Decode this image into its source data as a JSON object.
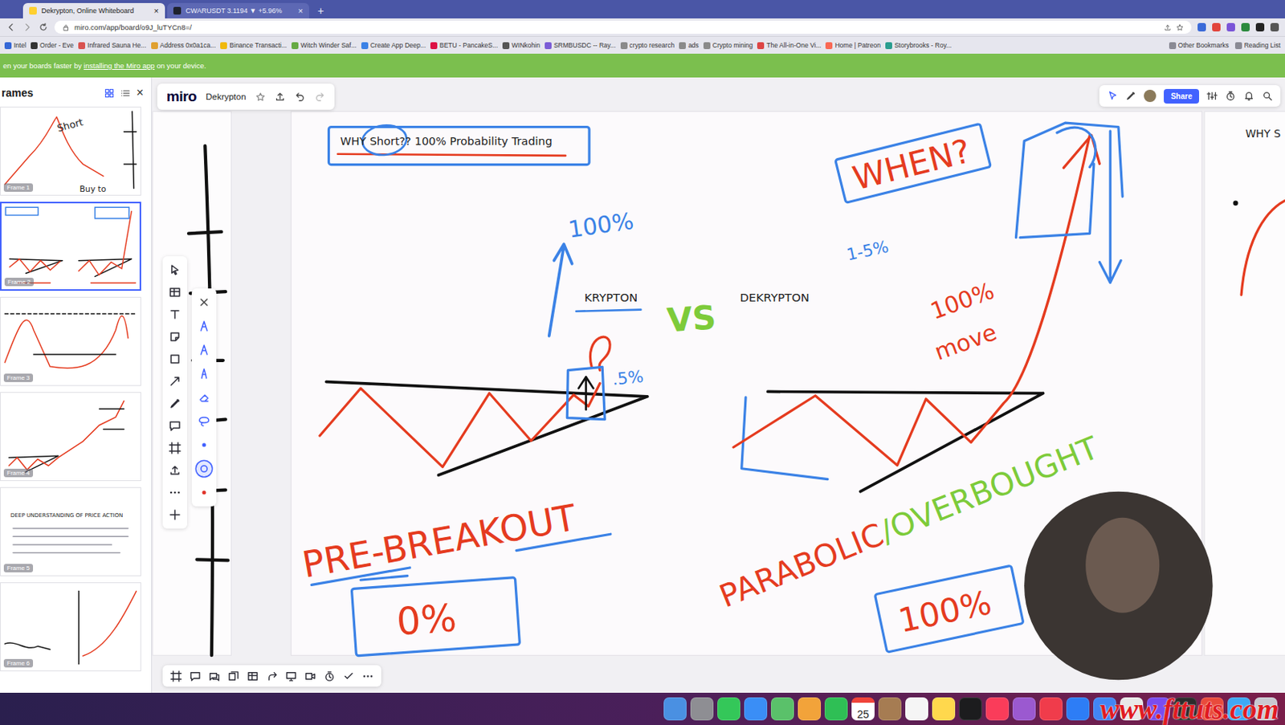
{
  "browser": {
    "tabs": [
      {
        "label": "Dekrypton, Online Whiteboard",
        "close": "×",
        "selected": true
      },
      {
        "label": "CWARUSDT 3.1194 ▼ +5.96%",
        "close": "×",
        "selected": false
      }
    ],
    "new_tab": "+",
    "url": "miro.com/app/board/o9J_luTYCn8=/",
    "bookmarks": [
      "Intel",
      "Order - Eve",
      "Infrared Sauna He...",
      "Address 0x0a1ca...",
      "Binance Transacti...",
      "Witch Winder Saf...",
      "Create App Deep...",
      "BETU - PancakeS...",
      "WINkohin",
      "SRMBUSDC -- Ray...",
      "crypto research",
      "ads",
      "Crypto mining",
      "The All-in-One Vi...",
      "Home | Patreon",
      "Storybrooks - Roy..."
    ],
    "bookmarks_right": [
      "Other Bookmarks",
      "Reading List"
    ]
  },
  "banner": {
    "before": "en your boards faster by ",
    "link": "installing the Miro app",
    "after": " on your device."
  },
  "frames_panel": {
    "title": "rames",
    "close": "×",
    "frames": [
      {
        "label": "Frame 1",
        "kind": "peak",
        "selected": false,
        "texts": [
          "Short",
          "Buy to"
        ]
      },
      {
        "label": "Frame 2",
        "kind": "compare",
        "selected": true,
        "texts": []
      },
      {
        "label": "Frame 3",
        "kind": "double",
        "selected": false,
        "texts": []
      },
      {
        "label": "Frame 4",
        "kind": "breakout",
        "selected": false,
        "texts": []
      },
      {
        "label": "Frame 5",
        "kind": "text",
        "selected": false,
        "texts": [
          "DEEP UNDERSTANDING OF PRICE ACTION"
        ]
      },
      {
        "label": "Frame 6",
        "kind": "chart",
        "selected": false,
        "texts": []
      }
    ]
  },
  "toolbar": {
    "logo": "miro",
    "board_name": "Dekrypton",
    "share": "Share"
  },
  "tools": [
    {
      "kind": "select"
    },
    {
      "kind": "table"
    },
    {
      "kind": "text"
    },
    {
      "kind": "sticky"
    },
    {
      "kind": "shape"
    },
    {
      "kind": "arrow"
    },
    {
      "kind": "pen"
    },
    {
      "kind": "comment"
    },
    {
      "kind": "frame"
    },
    {
      "kind": "upload"
    },
    {
      "kind": "more"
    },
    {
      "kind": "apps"
    }
  ],
  "pen_panel": [
    {
      "kind": "close",
      "selected": false
    },
    {
      "kind": "pen2",
      "selected": false
    },
    {
      "kind": "pen2",
      "selected": false
    },
    {
      "kind": "highlighter",
      "selected": false
    },
    {
      "kind": "eraser",
      "selected": false
    },
    {
      "kind": "lasso",
      "selected": false
    },
    {
      "kind": "dot",
      "selected": false
    },
    {
      "kind": "ring",
      "selected": true
    },
    {
      "kind": "reddot",
      "selected": false
    }
  ],
  "board": {
    "annotations": [
      {
        "text": "WHY Short?? 100% Probability Trading",
        "kind": "label",
        "color": "#222222"
      },
      {
        "text": "KRYPTON",
        "kind": "label",
        "color": "#222222"
      },
      {
        "text": "VS",
        "kind": "label",
        "color": "#7dcb3a"
      },
      {
        "text": "DEKRYPTON",
        "kind": "label",
        "color": "#222222"
      },
      {
        "text": "100%",
        "kind": "label",
        "color": "#3b82e6"
      },
      {
        "text": ".5%",
        "kind": "label",
        "color": "#3b82e6"
      },
      {
        "text": "WHEN?",
        "kind": "label",
        "color": "#e53b1f"
      },
      {
        "text": "1-5%",
        "kind": "label",
        "color": "#3b82e6"
      },
      {
        "text": "100%",
        "kind": "label",
        "color": "#e53b1f"
      },
      {
        "text": "move",
        "kind": "label",
        "color": "#e53b1f"
      },
      {
        "text": "PRE-BREAKOUT",
        "kind": "label",
        "color": "#e53b1f"
      },
      {
        "text": "0%",
        "kind": "label",
        "color": "#e53b1f"
      },
      {
        "text": "PARABOLIC",
        "kind": "label",
        "color": "#e53b1f"
      },
      {
        "text": "/OVERBOUGHT",
        "kind": "continuation",
        "color": "#7dcb3a"
      },
      {
        "text": "100%",
        "kind": "label",
        "color": "#e53b1f"
      },
      {
        "text": "WHY S",
        "kind": "label",
        "color": "#222222"
      }
    ]
  },
  "bottom_toolbar": [
    {
      "kind": "frame"
    },
    {
      "kind": "comment"
    },
    {
      "kind": "chat"
    },
    {
      "kind": "cards"
    },
    {
      "kind": "table"
    },
    {
      "kind": "share"
    },
    {
      "kind": "screen"
    },
    {
      "kind": "video"
    },
    {
      "kind": "timer"
    },
    {
      "kind": "vote"
    },
    {
      "kind": "more"
    }
  ],
  "dock": {
    "apps": [
      {
        "kind": "app",
        "color": "#4a90e2"
      },
      {
        "kind": "app",
        "color": "#8e8e93"
      },
      {
        "kind": "app",
        "color": "#34c759"
      },
      {
        "kind": "app",
        "color": "#3a8ef6"
      },
      {
        "kind": "app",
        "color": "#5ac16a"
      },
      {
        "kind": "app",
        "color": "#f2a33a"
      },
      {
        "kind": "app",
        "color": "#2fbf55"
      },
      {
        "kind": "calendar",
        "label": "25"
      },
      {
        "kind": "app",
        "color": "#a67c52"
      },
      {
        "kind": "app",
        "color": "#f5f5f5"
      },
      {
        "kind": "app",
        "color": "#ffd84d"
      },
      {
        "kind": "app",
        "color": "#1c1c1e"
      },
      {
        "kind": "app",
        "color": "#fa3c5a"
      },
      {
        "kind": "app",
        "color": "#9b59d0"
      },
      {
        "kind": "app",
        "color": "#f03c4b"
      },
      {
        "kind": "app",
        "color": "#2d7df6"
      },
      {
        "kind": "app",
        "color": "#4285f4"
      },
      {
        "kind": "app",
        "color": "#e8e8e8"
      },
      {
        "kind": "app",
        "color": "#7a4cf0"
      },
      {
        "kind": "app",
        "color": "#2b2b2b"
      },
      {
        "kind": "app",
        "color": "#e94b3c"
      },
      {
        "kind": "app",
        "color": "#3fa9f5"
      },
      {
        "kind": "app",
        "color": "#c9c9d1"
      }
    ]
  },
  "watermark": "www.fttuts.com"
}
